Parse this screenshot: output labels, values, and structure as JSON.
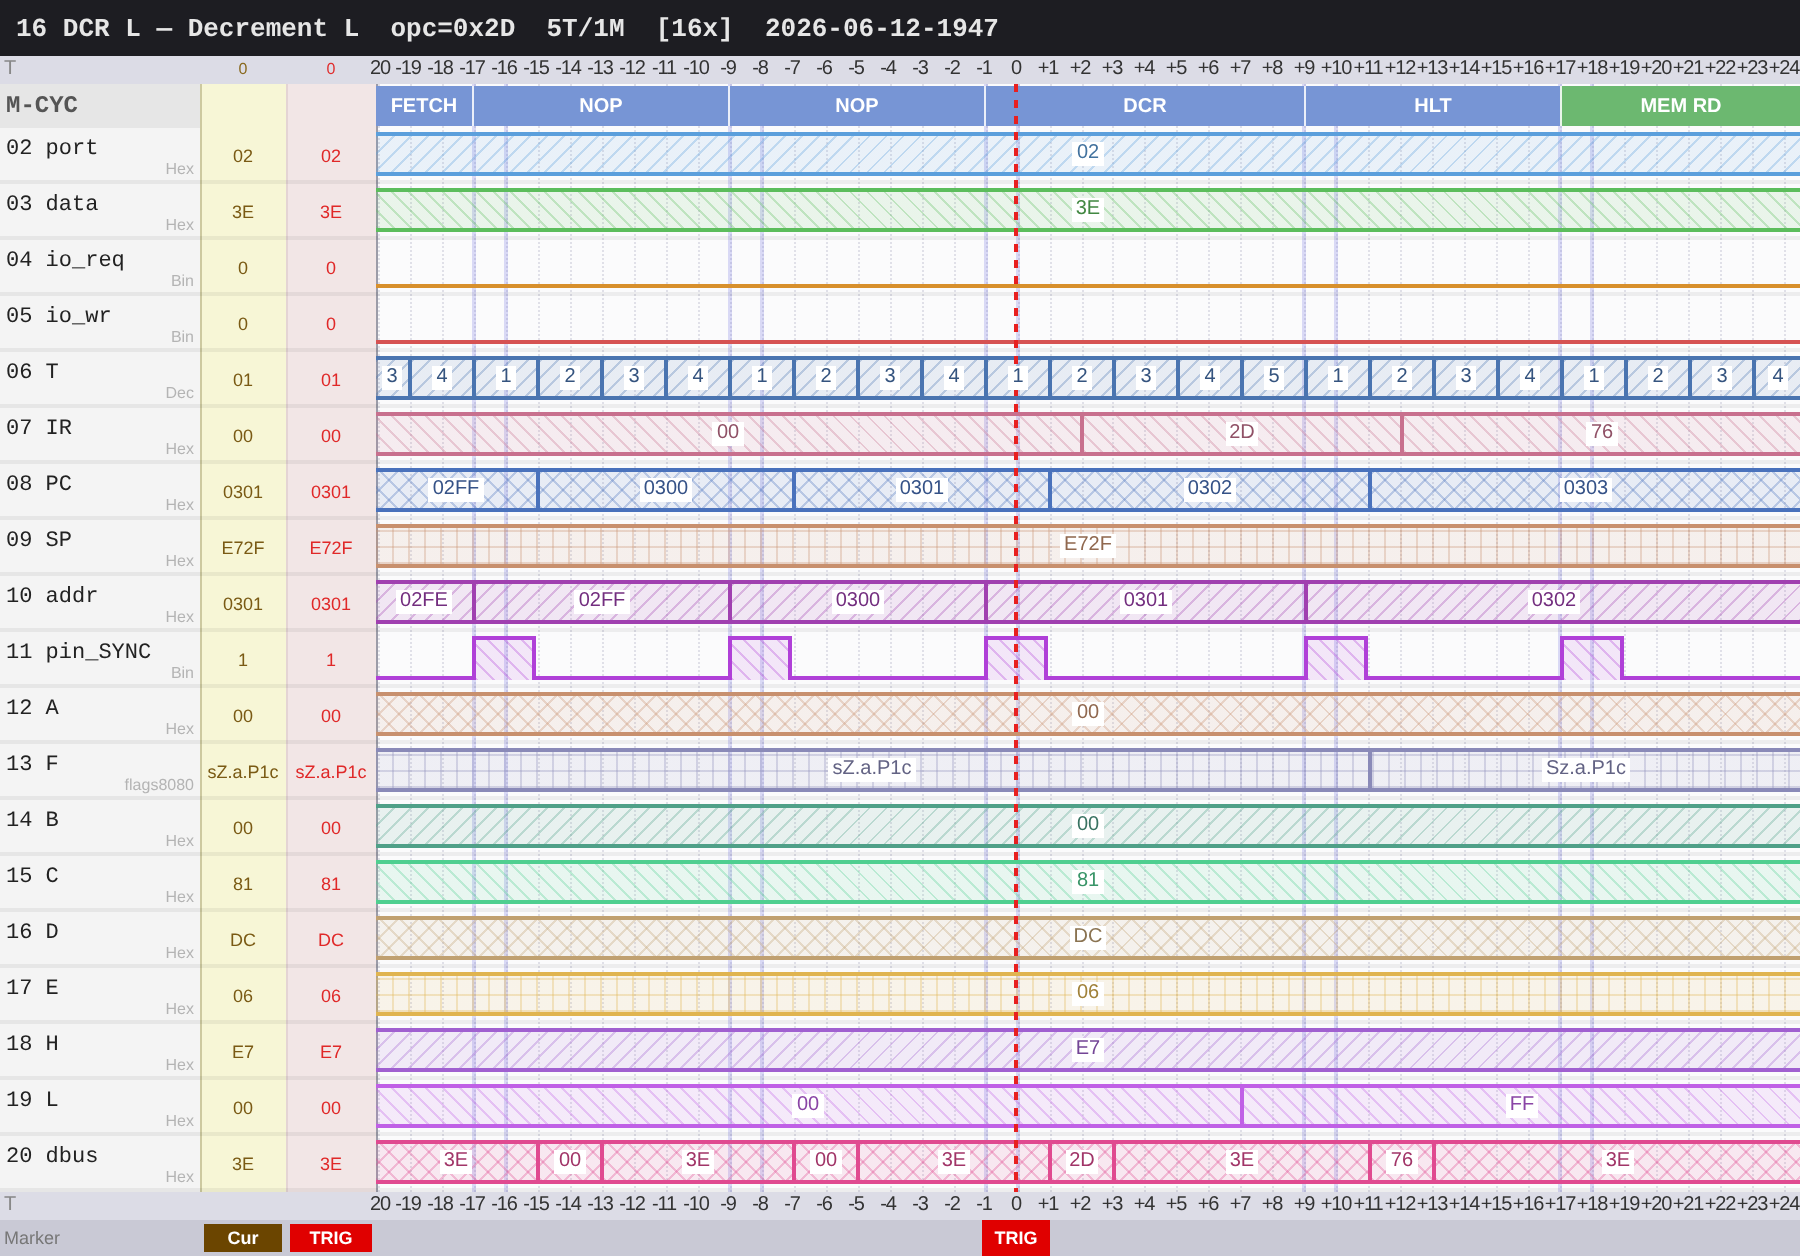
{
  "title": "16 DCR L — Decrement L  opc=0x2D  5T/1M  [16x]  2026-06-12-1947",
  "top_axis": {
    "label": "T",
    "cur_time": "0",
    "trig_time": "0",
    "ticks": [
      "20",
      "-19",
      "-18",
      "-17",
      "-16",
      "-15",
      "-14",
      "-13",
      "-12",
      "-11",
      "-10",
      "-9",
      "-8",
      "-7",
      "-6",
      "-5",
      "-4",
      "-3",
      "-2",
      "-1",
      "0",
      "+1",
      "+2",
      "+3",
      "+4",
      "+5",
      "+6",
      "+7",
      "+8",
      "+9",
      "+10",
      "+11",
      "+12",
      "+13",
      "+14",
      "+15",
      "+16",
      "+17",
      "+18",
      "+19",
      "+20",
      "+21",
      "+22",
      "+23",
      "+24"
    ]
  },
  "m_cycles": {
    "label": "M-CYC",
    "cycles": [
      {
        "label": "FETCH",
        "color": "#7795d5"
      },
      {
        "label": "NOP",
        "color": "#7795d5"
      },
      {
        "label": "NOP",
        "color": "#7795d5"
      },
      {
        "label": "DCR",
        "color": "#7795d5"
      },
      {
        "label": "HLT",
        "color": "#7795d5"
      },
      {
        "label": "MEM RD",
        "color": "#6cb870"
      }
    ]
  },
  "signals": [
    {
      "name": "02 port",
      "radix": "Hex",
      "cur": "02",
      "trig": "02",
      "kind": "diagonal",
      "color": "#5b9fdc",
      "segments": [
        {
          "value": "02"
        }
      ]
    },
    {
      "name": "03 data",
      "radix": "Hex",
      "cur": "3E",
      "trig": "3E",
      "kind": "backslash",
      "color": "#5cbd5c",
      "segments": [
        {
          "value": "3E"
        }
      ]
    },
    {
      "name": "04 io_req",
      "radix": "Bin",
      "cur": "0",
      "trig": "0",
      "kind": "bit",
      "color": "#d8902c",
      "segments": [
        {
          "high": false
        }
      ]
    },
    {
      "name": "05 io_wr",
      "radix": "Bin",
      "cur": "0",
      "trig": "0",
      "kind": "bit",
      "color": "#d65252",
      "segments": [
        {
          "high": false
        }
      ]
    },
    {
      "name": "06 T",
      "radix": "Dec",
      "cur": "01",
      "trig": "01",
      "kind": "diagonal",
      "color": "#4a74b0",
      "segments": [
        {
          "value": "3"
        },
        {
          "value": "4"
        },
        {
          "value": "1"
        },
        {
          "value": "2"
        },
        {
          "value": "3"
        },
        {
          "value": "4"
        },
        {
          "value": "1"
        },
        {
          "value": "2"
        },
        {
          "value": "3"
        },
        {
          "value": "4"
        },
        {
          "value": "1"
        },
        {
          "value": "2"
        },
        {
          "value": "3"
        },
        {
          "value": "4"
        },
        {
          "value": "5"
        },
        {
          "value": "1"
        },
        {
          "value": "2"
        },
        {
          "value": "3"
        },
        {
          "value": "4"
        },
        {
          "value": "1"
        },
        {
          "value": "2"
        },
        {
          "value": "3"
        },
        {
          "value": "4"
        }
      ]
    },
    {
      "name": "07 IR",
      "radix": "Hex",
      "cur": "00",
      "trig": "00",
      "kind": "backslash",
      "color": "#c8708e",
      "segments": [
        {
          "value": "00"
        },
        {
          "value": "2D"
        },
        {
          "value": "76"
        }
      ]
    },
    {
      "name": "08 PC",
      "radix": "Hex",
      "cur": "0301",
      "trig": "0301",
      "kind": "crosshatch",
      "color": "#4a72bc",
      "segments": [
        {
          "value": "02FF"
        },
        {
          "value": "0300"
        },
        {
          "value": "0301"
        },
        {
          "value": "0302"
        },
        {
          "value": "0303"
        }
      ]
    },
    {
      "name": "09 SP",
      "radix": "Hex",
      "cur": "E72F",
      "trig": "E72F",
      "kind": "grid",
      "color": "#c8906e",
      "segments": [
        {
          "value": "E72F"
        }
      ]
    },
    {
      "name": "10 addr",
      "radix": "Hex",
      "cur": "0301",
      "trig": "0301",
      "kind": "diagonal",
      "color": "#a040b0",
      "segments": [
        {
          "value": "02FE"
        },
        {
          "value": "02FF"
        },
        {
          "value": "0300"
        },
        {
          "value": "0301"
        },
        {
          "value": "0302"
        }
      ]
    },
    {
      "name": "11 pin_SYNC",
      "radix": "Bin",
      "cur": "1",
      "trig": "1",
      "kind": "bit",
      "color": "#b040d8",
      "segments": [
        {
          "high": false
        },
        {
          "high": true
        },
        {
          "high": false
        },
        {
          "high": true
        },
        {
          "high": false
        },
        {
          "high": true
        },
        {
          "high": false
        },
        {
          "high": true
        },
        {
          "high": false
        },
        {
          "high": true
        },
        {
          "high": false
        }
      ]
    },
    {
      "name": "12 A",
      "radix": "Hex",
      "cur": "00",
      "trig": "00",
      "kind": "crosshatch",
      "color": "#c8906e",
      "segments": [
        {
          "value": "00"
        }
      ]
    },
    {
      "name": "13 F",
      "radix": "flags8080",
      "cur": "sZ.a.P1c",
      "trig": "sZ.a.P1c",
      "kind": "grid",
      "color": "#8a8ab8",
      "segments": [
        {
          "value": "sZ.a.P1c"
        },
        {
          "value": "Sz.a.P1c"
        }
      ]
    },
    {
      "name": "14 B",
      "radix": "Hex",
      "cur": "00",
      "trig": "00",
      "kind": "diagonal",
      "color": "#4fa088",
      "segments": [
        {
          "value": "00"
        }
      ]
    },
    {
      "name": "15 C",
      "radix": "Hex",
      "cur": "81",
      "trig": "81",
      "kind": "backslash",
      "color": "#4fcf90",
      "segments": [
        {
          "value": "81"
        }
      ]
    },
    {
      "name": "16 D",
      "radix": "Hex",
      "cur": "DC",
      "trig": "DC",
      "kind": "crosshatch",
      "color": "#c0a070",
      "segments": [
        {
          "value": "DC"
        }
      ]
    },
    {
      "name": "17 E",
      "radix": "Hex",
      "cur": "06",
      "trig": "06",
      "kind": "grid",
      "color": "#e0b450",
      "segments": [
        {
          "value": "06"
        }
      ]
    },
    {
      "name": "18 H",
      "radix": "Hex",
      "cur": "E7",
      "trig": "E7",
      "kind": "diagonal",
      "color": "#a060d0",
      "segments": [
        {
          "value": "E7"
        }
      ]
    },
    {
      "name": "19 L",
      "radix": "Hex",
      "cur": "00",
      "trig": "00",
      "kind": "backslash",
      "color": "#c060e6",
      "segments": [
        {
          "value": "00"
        },
        {
          "value": "FF"
        }
      ]
    },
    {
      "name": "20 dbus",
      "radix": "Hex",
      "cur": "3E",
      "trig": "3E",
      "kind": "crosshatch",
      "color": "#e04a90",
      "segments": [
        {
          "value": "3E"
        },
        {
          "value": "00"
        },
        {
          "value": "3E"
        },
        {
          "value": "00"
        },
        {
          "value": "3E"
        },
        {
          "value": "2D"
        },
        {
          "value": "3E"
        },
        {
          "value": "76"
        },
        {
          "value": "3E"
        }
      ]
    }
  ],
  "bottom_axis": {
    "label": "T",
    "ticks": [
      "20",
      "-19",
      "-18",
      "-17",
      "-16",
      "-15",
      "-14",
      "-13",
      "-12",
      "-11",
      "-10",
      "-9",
      "-8",
      "-7",
      "-6",
      "-5",
      "-4",
      "-3",
      "-2",
      "-1",
      "0",
      "+1",
      "+2",
      "+3",
      "+4",
      "+5",
      "+6",
      "+7",
      "+8",
      "+9",
      "+10",
      "+11",
      "+12",
      "+13",
      "+14",
      "+15",
      "+16",
      "+17",
      "+18",
      "+19",
      "+20",
      "+21",
      "+22",
      "+23",
      "+24"
    ]
  },
  "marker_bar": {
    "label": "Marker",
    "cur_badge": "Cur",
    "trig_badge": "TRIG",
    "trigger_flag": "TRIG"
  }
}
